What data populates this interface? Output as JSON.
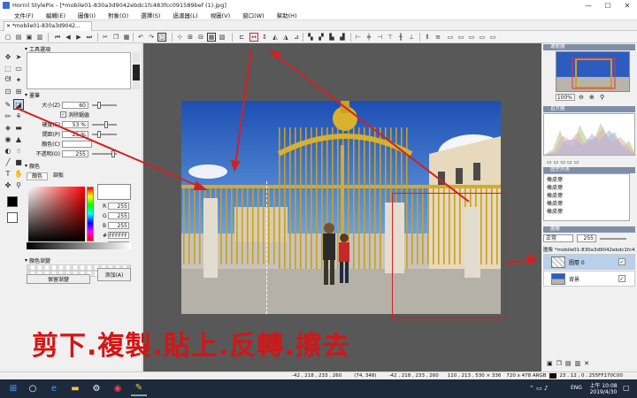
{
  "window": {
    "title": "Hornil StylePix - [*mobile01-830a3d9042ebdc1fc483fcc091589bef (1).jpg]",
    "min": "—",
    "max": "☐",
    "close": "✕"
  },
  "menu": [
    "文件(F)",
    "編輯(E)",
    "圖像(I)",
    "對象(O)",
    "選擇(S)",
    "過濾器(L)",
    "視圖(V)",
    "窗口(W)",
    "幫助(H)"
  ],
  "tab": {
    "label": "✕ *mobile01-830a3d9042..."
  },
  "left": {
    "tool_options_title": "工具選項",
    "brush_title": "畫筆",
    "size_label": "大小(Z)",
    "size_value": "60",
    "antialias_label": "消除鋸齒",
    "hardness_label": "硬度(E)",
    "hardness_value": "53 %",
    "spacing_label": "間距(P)",
    "spacing_value": "25 %",
    "color_label": "顏色(C)",
    "opacity_label": "不透明(O)",
    "opacity_value": "255",
    "color_title": "顏色",
    "color_tab": "顏色",
    "palette_tab": "調板",
    "r_value": "255",
    "g_value": "255",
    "b_value": "255",
    "hex_value": "FFFFFF",
    "a_value": "255",
    "gradient_title": "顏色漸變",
    "save_gradient": "保留漸變",
    "add_gradient": "添加(A)"
  },
  "right": {
    "navigator_title": "導航器",
    "zoom": "100%",
    "histogram_title": "直方圖",
    "history_title": "歷史列表",
    "history_items": [
      "橡皮擦",
      "橡皮擦",
      "橡皮擦",
      "橡皮擦",
      "橡皮擦"
    ],
    "layers_title": "圖層",
    "blend_mode": "正常",
    "opacity": "255",
    "image_name": "圖像 *mobile01-830a3d9042ebdc1fc483fcc0",
    "layer1": "圖層 0",
    "layer2": "背景"
  },
  "status": {
    "left": "-42 , 218 , 233 , 260",
    "mid": "(74, 348)",
    "coords2": "-42 , 218 , 233 , 260",
    "sel": "110 , 213 , 530 × 336",
    "size": "720 x 478 ARGB",
    "color": "23 , 12 , 0 , 255FF170C00"
  },
  "taskbar": {
    "lang": "ENG",
    "time": "上午 10:08",
    "date": "2019/4/30"
  },
  "caption": "剪下.複製.貼上.反轉.擦去",
  "colors": {
    "accent": "#d41515",
    "canvas_bg": "#585858",
    "panel_header": "#7f8fa8"
  }
}
